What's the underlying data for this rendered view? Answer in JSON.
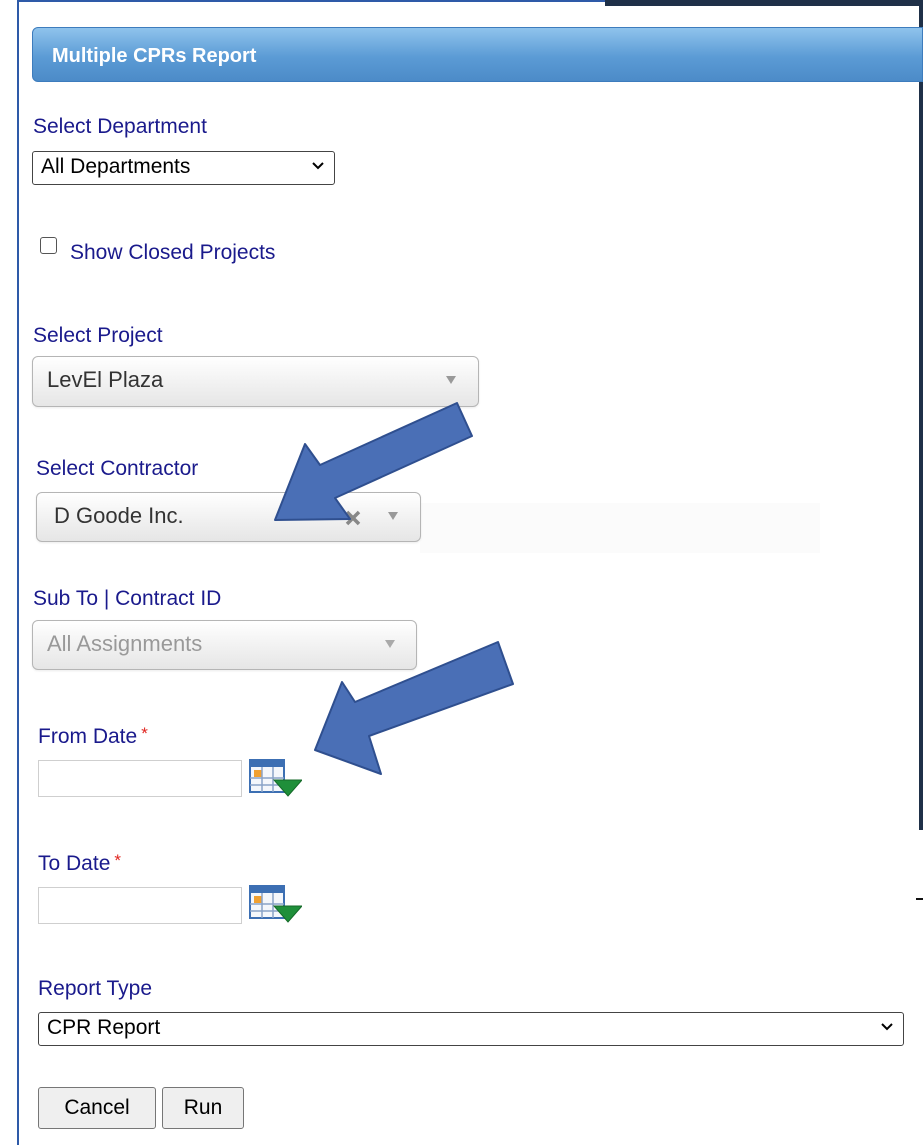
{
  "panel": {
    "title": "Multiple CPRs Report"
  },
  "department": {
    "label": "Select Department",
    "value": "All Departments"
  },
  "closed_projects": {
    "label": "Show Closed Projects",
    "checked": false
  },
  "project": {
    "label": "Select Project",
    "value": "LevEl Plaza"
  },
  "contractor": {
    "label": "Select Contractor",
    "value": "D Goode Inc."
  },
  "assignment": {
    "label": "Sub To | Contract ID",
    "value": "All Assignments"
  },
  "from_date": {
    "label": "From Date",
    "required": "*",
    "value": ""
  },
  "to_date": {
    "label": "To Date",
    "required": "*",
    "value": ""
  },
  "report_type": {
    "label": "Report Type",
    "value": "CPR Report"
  },
  "buttons": {
    "cancel": "Cancel",
    "run": "Run"
  },
  "annotations": {
    "arrow_color": "#4a6fb6",
    "arrow_border": "#2f4f8f"
  },
  "icons": [
    "chevron-down-icon",
    "clear-x-icon",
    "calendar-icon",
    "annotation-arrow"
  ]
}
